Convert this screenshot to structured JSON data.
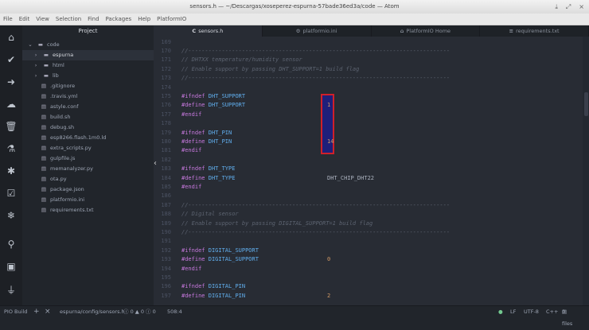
{
  "window": {
    "title": "sensors.h — ~/Descargas/xoseperez-espurna-57bade36ed3a/code — Atom",
    "minimize": "⤓",
    "maximize": "⤢",
    "close": "×"
  },
  "menu": [
    "File",
    "Edit",
    "View",
    "Selection",
    "Find",
    "Packages",
    "Help",
    "PlatformIO"
  ],
  "iconbar": [
    "home-icon",
    "check-icon",
    "arrow-right-icon",
    "cloud-upload-icon",
    "trash-icon",
    "flask-icon",
    "bug-icon",
    "checklist-icon",
    "network-icon",
    "search-icon",
    "terminal-icon",
    "plug-icon"
  ],
  "tree": {
    "header": "Project",
    "root": "code",
    "items": [
      {
        "label": "espurna",
        "type": "folder",
        "selected": true
      },
      {
        "label": "html",
        "type": "folder"
      },
      {
        "label": "lib",
        "type": "folder"
      },
      {
        "label": ".gitignore",
        "type": "file"
      },
      {
        "label": ".travis.yml",
        "type": "file"
      },
      {
        "label": "astyle.conf",
        "type": "file"
      },
      {
        "label": "build.sh",
        "type": "file"
      },
      {
        "label": "debug.sh",
        "type": "file"
      },
      {
        "label": "esp8266.flash.1m0.ld",
        "type": "file"
      },
      {
        "label": "extra_scripts.py",
        "type": "file"
      },
      {
        "label": "gulpfile.js",
        "type": "file"
      },
      {
        "label": "memanalyzer.py",
        "type": "file"
      },
      {
        "label": "ota.py",
        "type": "file"
      },
      {
        "label": "package.json",
        "type": "file"
      },
      {
        "label": "platformio.ini",
        "type": "file"
      },
      {
        "label": "requirements.txt",
        "type": "file"
      }
    ]
  },
  "tabs": [
    {
      "label": "sensors.h",
      "icon": "C",
      "active": true
    },
    {
      "label": "platformio.ini",
      "icon": "⚙"
    },
    {
      "label": "PlatformIO Home",
      "icon": "⌂"
    },
    {
      "label": "requirements.txt",
      "icon": "≡"
    }
  ],
  "code": [
    {
      "n": "169"
    },
    {
      "n": "170",
      "c": "//------------------------------------------------------------------------------"
    },
    {
      "n": "171",
      "c": "// DHTXX temperature/humidity sensor"
    },
    {
      "n": "172",
      "c": "// Enable support by passing DHT_SUPPORT=1 build flag"
    },
    {
      "n": "173",
      "c": "//------------------------------------------------------------------------------"
    },
    {
      "n": "174"
    },
    {
      "n": "175",
      "k": "#ifndef",
      "m": "DHT_SUPPORT"
    },
    {
      "n": "176",
      "k": "#define",
      "m": "DHT_SUPPORT",
      "v": "1",
      "vt": "num"
    },
    {
      "n": "177",
      "k": "#endif"
    },
    {
      "n": "178"
    },
    {
      "n": "179",
      "k": "#ifndef",
      "m": "DHT_PIN"
    },
    {
      "n": "180",
      "k": "#define",
      "m": "DHT_PIN",
      "v": "14",
      "vt": "num"
    },
    {
      "n": "181",
      "k": "#endif"
    },
    {
      "n": "182"
    },
    {
      "n": "183",
      "k": "#ifndef",
      "m": "DHT_TYPE"
    },
    {
      "n": "184",
      "k": "#define",
      "m": "DHT_TYPE",
      "v": "DHT_CHIP_DHT22",
      "vt": "txt"
    },
    {
      "n": "185",
      "k": "#endif"
    },
    {
      "n": "186"
    },
    {
      "n": "187",
      "c": "//------------------------------------------------------------------------------"
    },
    {
      "n": "188",
      "c": "// Digital sensor"
    },
    {
      "n": "189",
      "c": "// Enable support by passing DIGITAL_SUPPORT=1 build flag"
    },
    {
      "n": "190",
      "c": "//------------------------------------------------------------------------------"
    },
    {
      "n": "191"
    },
    {
      "n": "192",
      "k": "#ifndef",
      "m": "DIGITAL_SUPPORT"
    },
    {
      "n": "193",
      "k": "#define",
      "m": "DIGITAL_SUPPORT",
      "v": "0",
      "vt": "num"
    },
    {
      "n": "194",
      "k": "#endif"
    },
    {
      "n": "195"
    },
    {
      "n": "196",
      "k": "#ifndef",
      "m": "DIGITAL_PIN"
    },
    {
      "n": "197",
      "k": "#define",
      "m": "DIGITAL_PIN",
      "v": "2",
      "vt": "num"
    }
  ],
  "status": {
    "build": "PIO Build",
    "add": "+",
    "close": "×",
    "path": "espurna/config/sensors.h",
    "errors": "ⓘ 0 ▲ 0 ⓘ 0",
    "cursor": "508:4",
    "eol": "LF",
    "encoding": "UTF-8",
    "grammar": "C++",
    "files": "0 files"
  }
}
